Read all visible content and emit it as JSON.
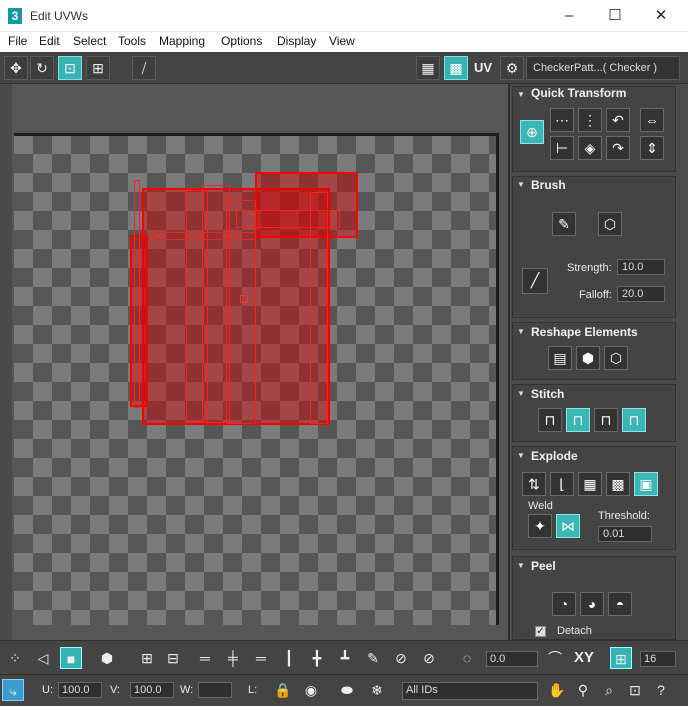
{
  "window": {
    "title": "Edit UVWs",
    "logo": "3",
    "minimize": "–",
    "maximize": "☐",
    "close": "✕"
  },
  "menu": [
    "File",
    "Edit",
    "Select",
    "Tools",
    "Mapping",
    "Options",
    "Display",
    "View"
  ],
  "toolbar": {
    "uv_label": "UV",
    "texture": "CheckerPatt...( Checker )"
  },
  "panel": {
    "quick_transform": "Quick Transform",
    "brush": "Brush",
    "strength_label": "Strength:",
    "strength_value": "10.0",
    "falloff_label": "Falloff:",
    "falloff_value": "20.0",
    "reshape": "Reshape Elements",
    "stitch": "Stitch",
    "explode": "Explode",
    "weld": "Weld",
    "threshold_label": "Threshold:",
    "threshold_value": "0.01",
    "peel": "Peel",
    "detach": "Detach",
    "detach_checked": true
  },
  "bottom": {
    "rotate_value": "0.0",
    "xy_label": "XY",
    "grid_value": "16",
    "u_label": "U:",
    "u_value": "100.0",
    "v_label": "V:",
    "v_value": "100.0",
    "w_label": "W:",
    "w_value": "",
    "l_label": "L:",
    "ids": "All IDs"
  },
  "colors": {
    "accent": "#3cb5b5",
    "uv_selection": "#ff0000"
  }
}
